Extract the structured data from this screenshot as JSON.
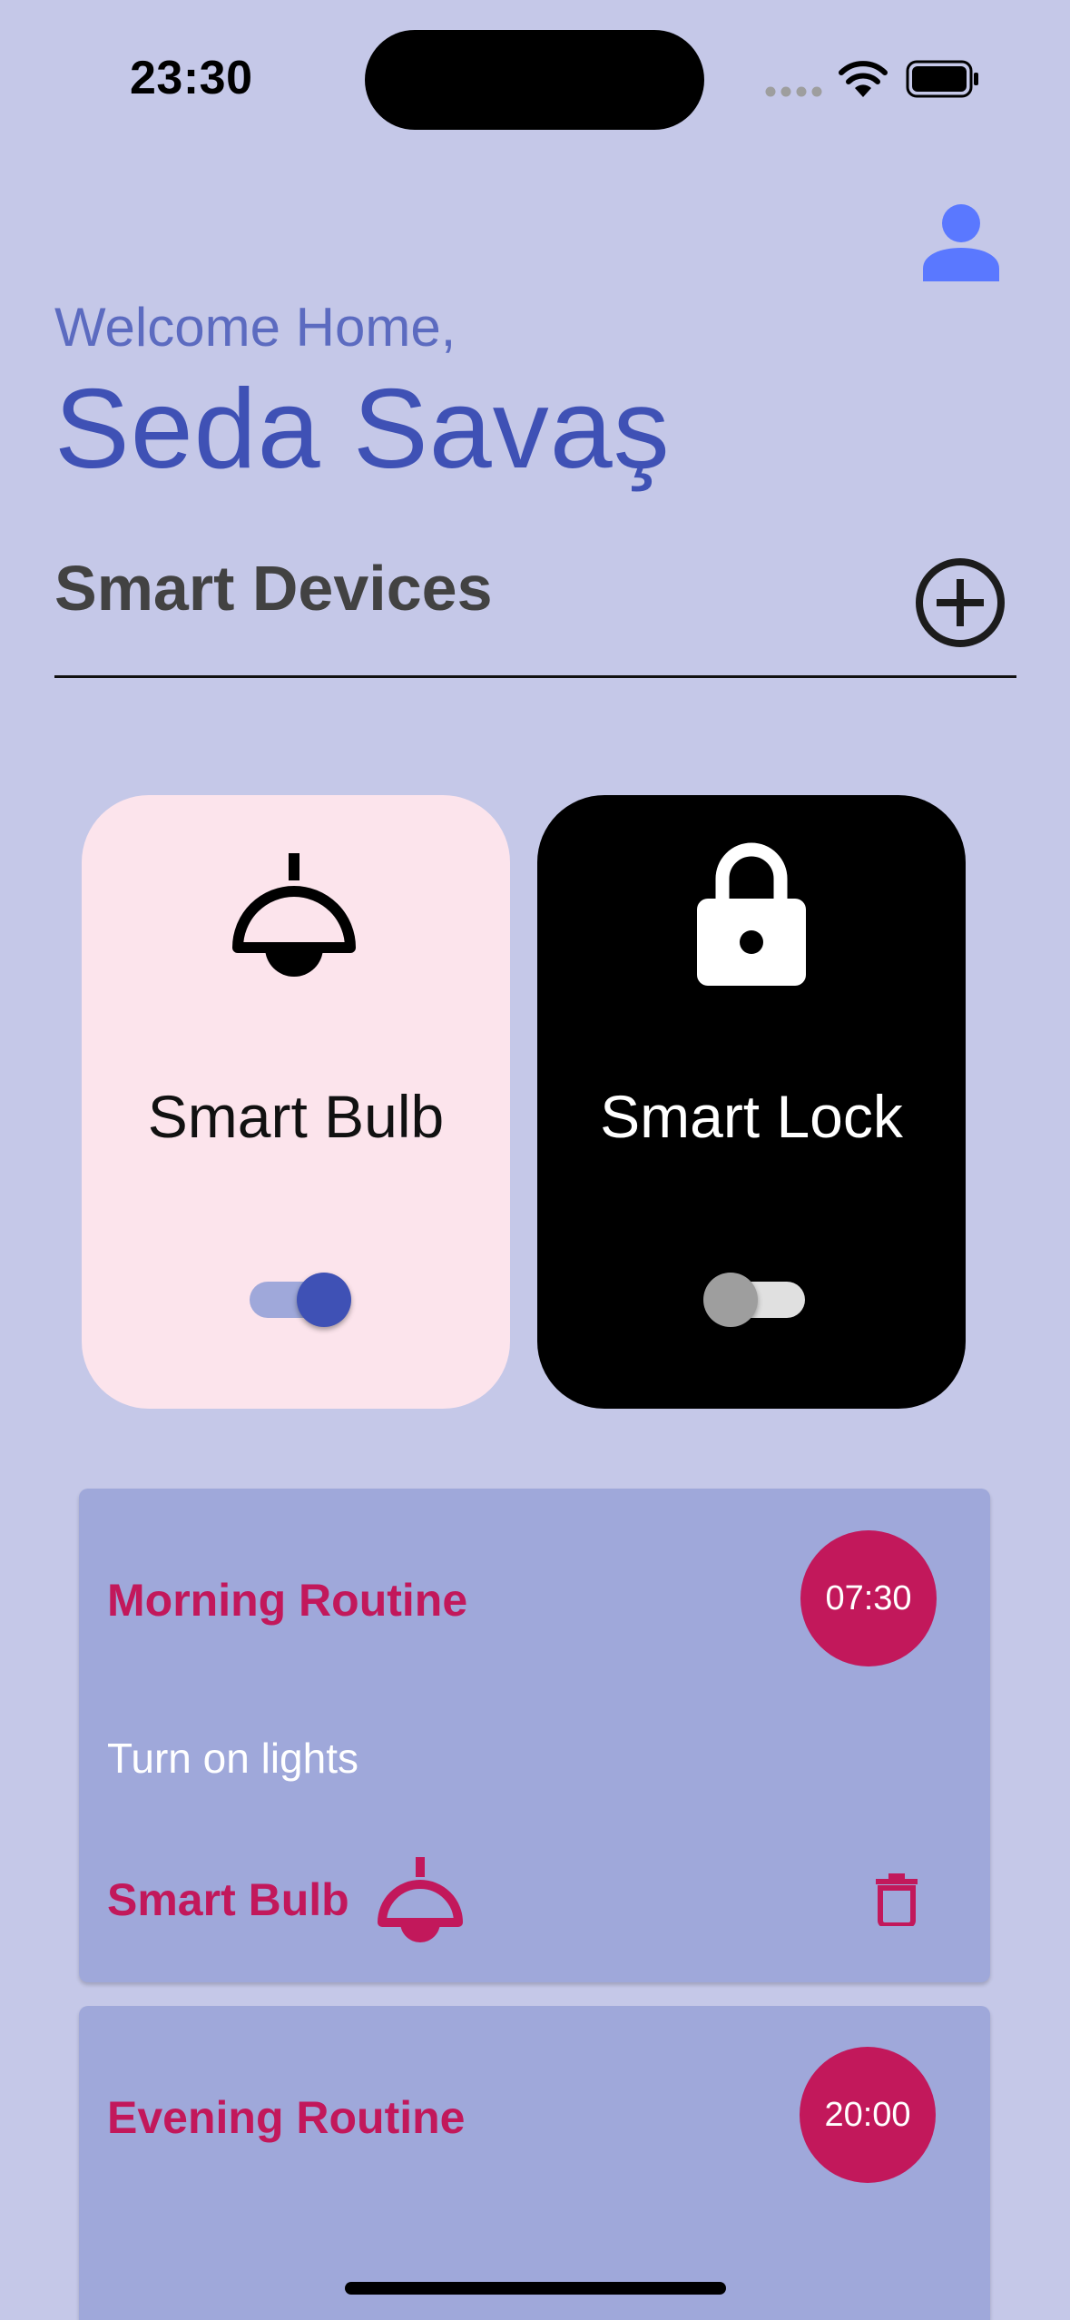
{
  "status_bar": {
    "time": "23:30",
    "icons": [
      "signal-dots-icon",
      "wifi-icon",
      "battery-icon"
    ]
  },
  "header": {
    "welcome_text": "Welcome Home,",
    "user_name": "Seda Savaş",
    "profile_icon": "person-icon"
  },
  "devices_section": {
    "title": "Smart Devices",
    "add_icon": "add-circle-icon"
  },
  "devices": [
    {
      "name": "Smart Bulb",
      "icon": "ceiling-lamp-icon",
      "enabled": true,
      "card_color": "#fce4ec"
    },
    {
      "name": "Smart Lock",
      "icon": "lock-icon",
      "enabled": false,
      "card_color": "#000000"
    }
  ],
  "routines": [
    {
      "title": "Morning Routine",
      "time": "07:30",
      "action": "Turn on lights",
      "device": "Smart Bulb",
      "device_icon": "ceiling-lamp-icon"
    },
    {
      "title": "Evening Routine",
      "time": "20:00"
    }
  ],
  "colors": {
    "background": "#c5c8e8",
    "primary": "#3f51b5",
    "accent": "#c2185b",
    "routine_card": "#9fa8da"
  }
}
